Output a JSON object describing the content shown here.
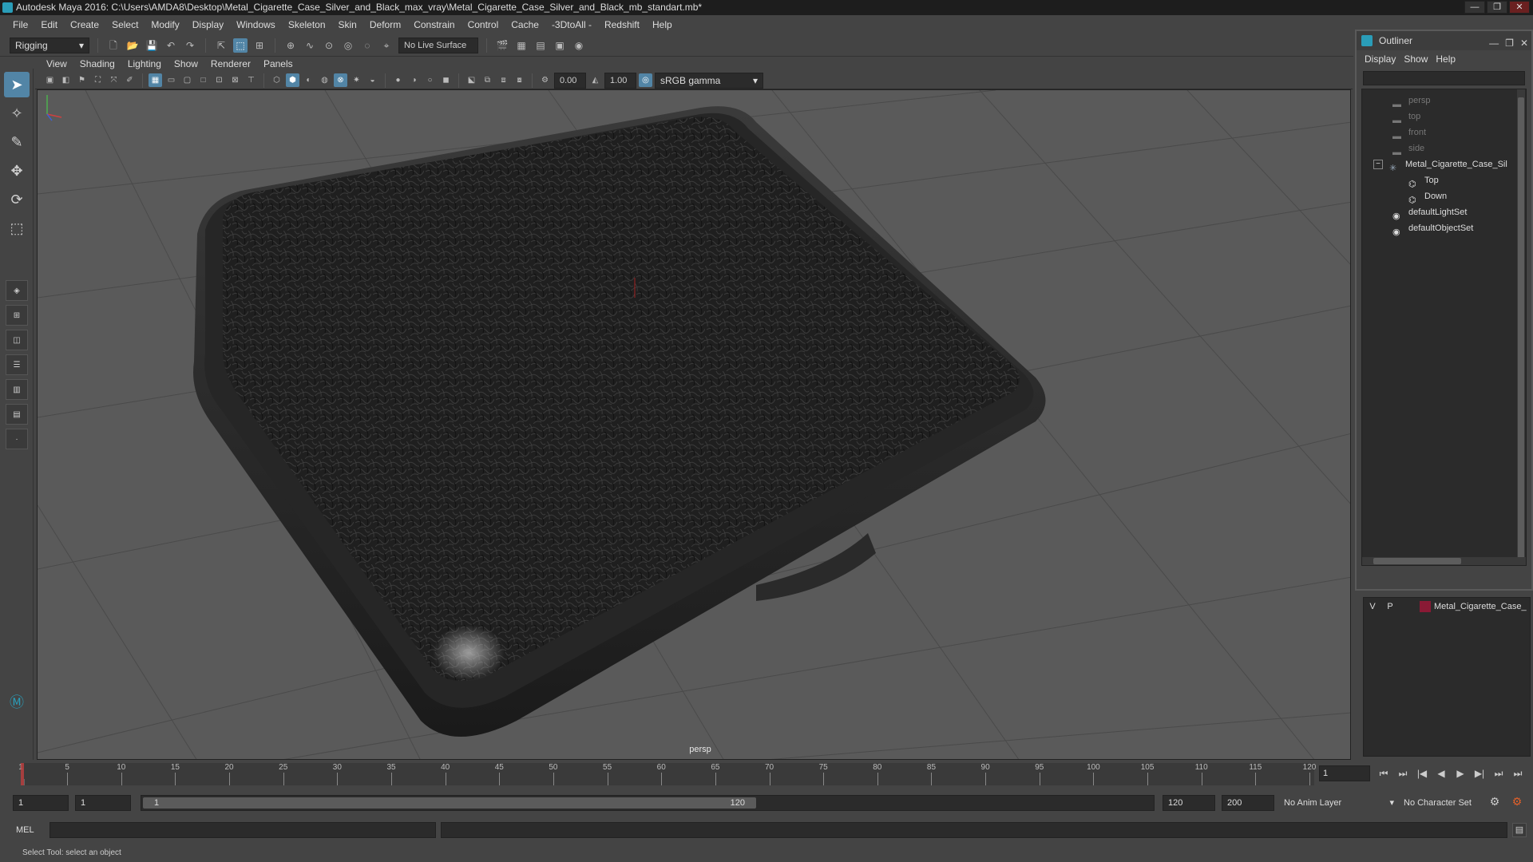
{
  "window": {
    "title": "Autodesk Maya 2016: C:\\Users\\AMDA8\\Desktop\\Metal_Cigarette_Case_Silver_and_Black_max_vray\\Metal_Cigarette_Case_Silver_and_Black_mb_standart.mb*",
    "min": "—",
    "max": "❐",
    "close": "✕"
  },
  "menubar": [
    "File",
    "Edit",
    "Create",
    "Select",
    "Modify",
    "Display",
    "Windows",
    "Skeleton",
    "Skin",
    "Deform",
    "Constrain",
    "Control",
    "Cache",
    "-3DtoAll -",
    "Redshift",
    "Help"
  ],
  "statusline": {
    "mode": "Rigging",
    "live_surface": "No Live Surface"
  },
  "panel": {
    "menus": [
      "View",
      "Shading",
      "Lighting",
      "Show",
      "Renderer",
      "Panels"
    ],
    "exposure": "0.00",
    "gamma": "1.00",
    "color_space": "sRGB gamma",
    "camera": "persp"
  },
  "outliner": {
    "title": "Outliner",
    "menus": [
      "Display",
      "Show",
      "Help"
    ],
    "nodes": [
      {
        "label": "persp",
        "dim": true
      },
      {
        "label": "top",
        "dim": true
      },
      {
        "label": "front",
        "dim": true
      },
      {
        "label": "side",
        "dim": true
      },
      {
        "label": "Metal_Cigarette_Case_Sil",
        "dim": false
      },
      {
        "label": "Top",
        "dim": false
      },
      {
        "label": "Down",
        "dim": false
      },
      {
        "label": "defaultLightSet",
        "dim": false
      },
      {
        "label": "defaultObjectSet",
        "dim": false
      }
    ]
  },
  "layers": {
    "v": "V",
    "p": "P",
    "name": "Metal_Cigarette_Case_",
    "color": "#8a1a35"
  },
  "timeline": {
    "labels": [
      "5",
      "10",
      "15",
      "20",
      "25",
      "30",
      "35",
      "40",
      "45",
      "50",
      "55",
      "60",
      "65",
      "70",
      "75",
      "80",
      "85",
      "90",
      "95",
      "100",
      "105",
      "110",
      "115",
      "120"
    ],
    "start_marker": "1",
    "current_frame": "1"
  },
  "range": {
    "start": "1",
    "playback_start": "1",
    "thumb_start": "1",
    "thumb_end": "120",
    "playback_end": "120",
    "end": "200",
    "anim_layer": "No Anim Layer",
    "character_set": "No Character Set"
  },
  "command": {
    "mel": "MEL"
  },
  "help": {
    "text": "Select Tool: select an object"
  }
}
